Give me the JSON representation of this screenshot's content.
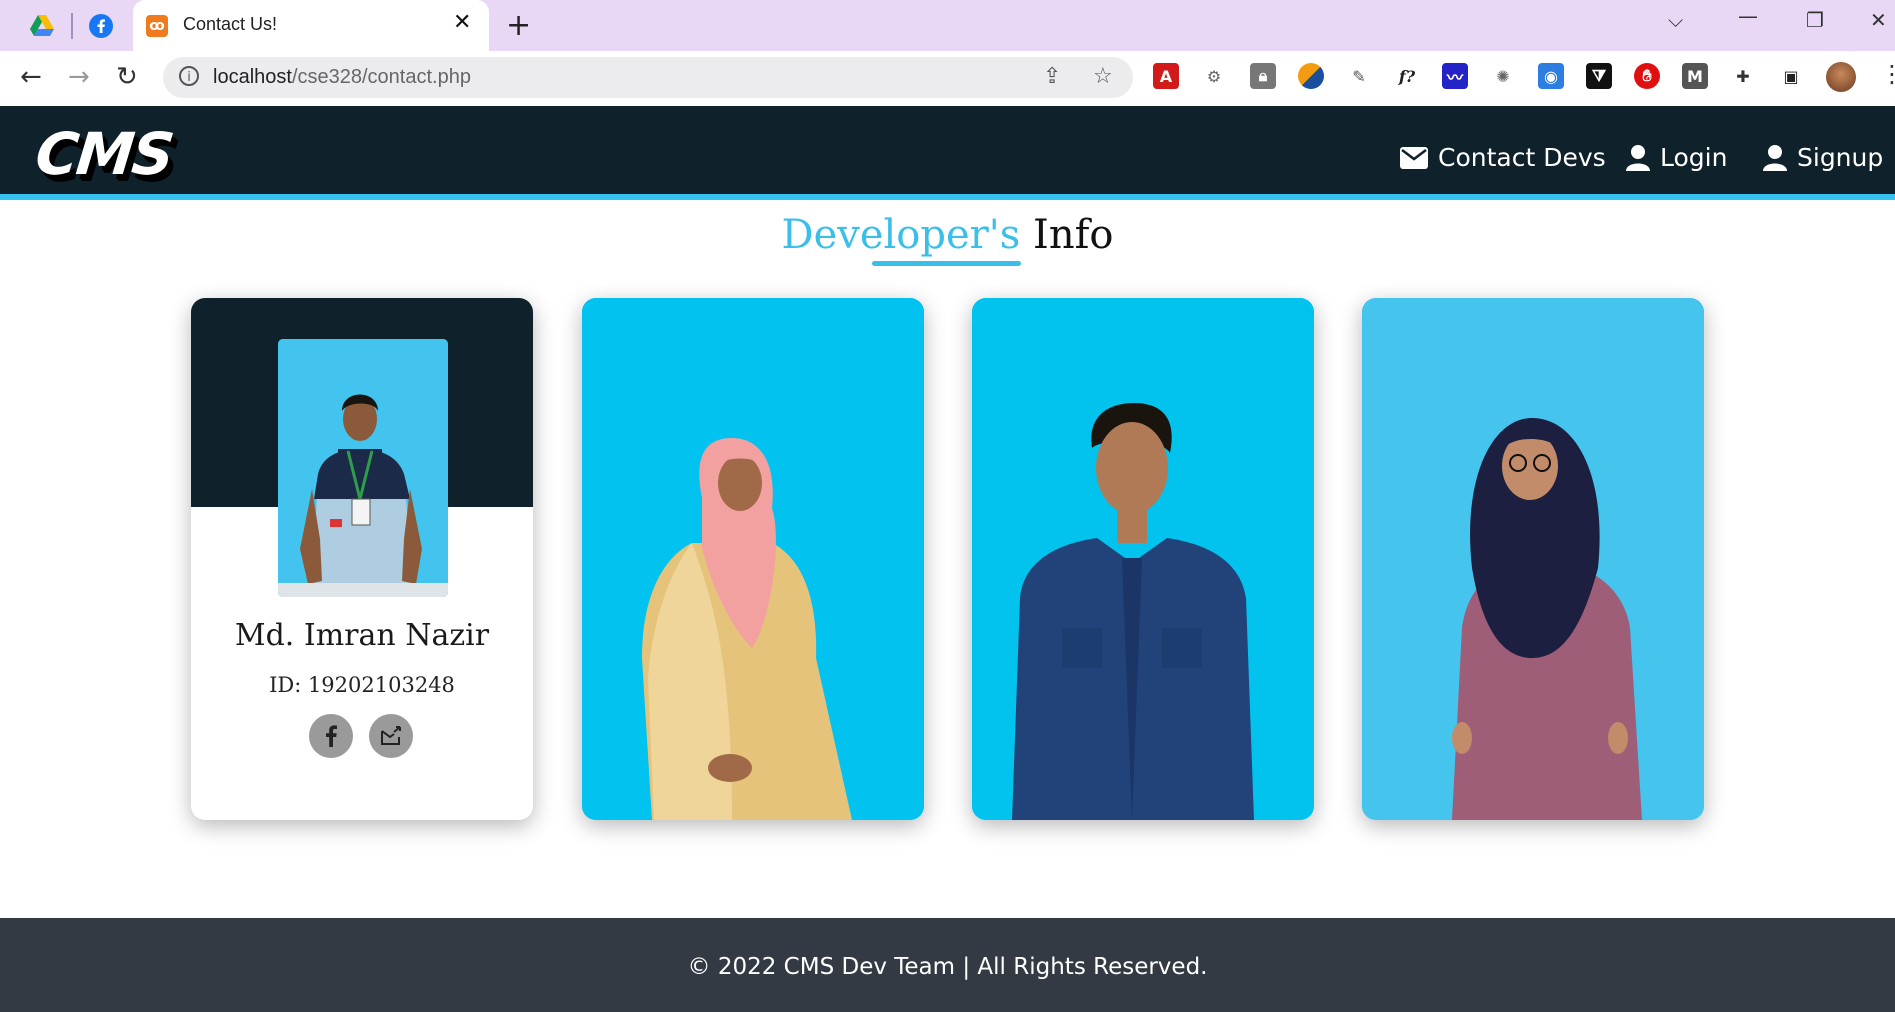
{
  "browser": {
    "active_tab_title": "Contact Us!",
    "url_host": "localhost",
    "url_path": "/cse328/contact.php",
    "pinned_tabs": [
      "google-drive-icon",
      "facebook-icon"
    ]
  },
  "site": {
    "logo_text": "CMS",
    "nav": [
      {
        "label": "Contact Devs",
        "icon": "envelope-icon"
      },
      {
        "label": "Login",
        "icon": "user-icon"
      },
      {
        "label": "Signup",
        "icon": "user-icon"
      }
    ]
  },
  "heading": {
    "accent": "Developer's",
    "rest": " Info"
  },
  "developers": [
    {
      "name": "Md. Imran Nazir",
      "id_text": "ID: 19202103248",
      "social": [
        "facebook-icon",
        "mail-icon"
      ]
    }
  ],
  "footer": {
    "text": "© 2022 CMS Dev Team | All Rights Reserved."
  },
  "colors": {
    "navbar_bg": "#0f212a",
    "accent": "#3bbfe8",
    "footer_bg": "#343a44",
    "card_photo_bg": "#02c2ef"
  }
}
